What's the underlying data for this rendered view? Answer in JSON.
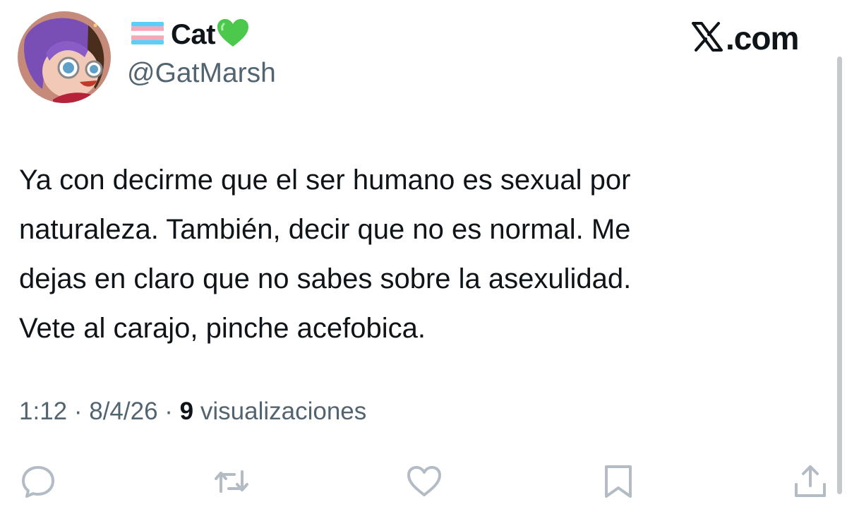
{
  "author": {
    "flag_icon": "transgender-flag-icon",
    "display_name": "Cat",
    "badge_icon": "green-heart-icon",
    "handle": "@GatMarsh"
  },
  "brand": {
    "text": ".com",
    "icon": "x-logo-icon"
  },
  "tweet": {
    "lines": [
      "Ya con decirme que el ser humano es sexual por",
      "naturaleza. También, decir que no es normal. Me",
      "dejas en claro que no sabes sobre la asexulidad.",
      "Vete al carajo, pinche acefobica."
    ]
  },
  "meta": {
    "time": "1:12",
    "separator": " · ",
    "date": "8/4/26",
    "views_count": "9",
    "views_label": "visualizaciones"
  },
  "actions": [
    "reply-icon",
    "retweet-icon",
    "like-icon",
    "bookmark-icon",
    "share-icon"
  ],
  "colors": {
    "text": "#0f1419",
    "secondary": "#536471",
    "heart": "#4cc94c",
    "icon": "#b3bcc5"
  }
}
